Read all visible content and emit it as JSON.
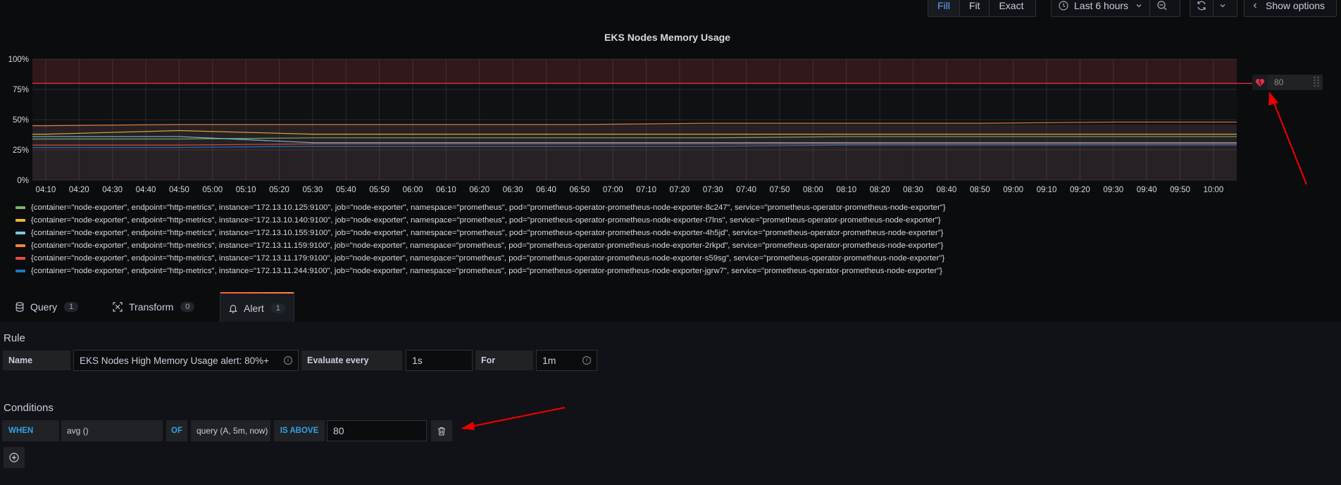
{
  "toolbar": {
    "fill_label": "Fill",
    "fit_label": "Fit",
    "exact_label": "Exact",
    "time_range": "Last 6 hours",
    "show_options_label": "Show options"
  },
  "graph": {
    "title": "EKS Nodes Memory Usage",
    "threshold_handle_value": "80",
    "y_ticks": [
      "100%",
      "75%",
      "50%",
      "25%",
      "0%"
    ],
    "x_ticks": [
      "04:10",
      "04:20",
      "04:30",
      "04:40",
      "04:50",
      "05:00",
      "05:10",
      "05:20",
      "05:30",
      "05:40",
      "05:50",
      "06:00",
      "06:10",
      "06:20",
      "06:30",
      "06:40",
      "06:50",
      "07:00",
      "07:10",
      "07:20",
      "07:30",
      "07:40",
      "07:50",
      "08:00",
      "08:10",
      "08:20",
      "08:30",
      "08:40",
      "08:50",
      "09:00",
      "09:10",
      "09:20",
      "09:30",
      "09:40",
      "09:50",
      "10:00"
    ]
  },
  "chart_data": {
    "type": "line",
    "title": "EKS Nodes Memory Usage",
    "xlabel": "",
    "ylabel": "",
    "ylim": [
      0,
      100
    ],
    "y_unit": "%",
    "threshold": 80,
    "x_range": [
      "04:06",
      "10:07"
    ],
    "categories": [
      "04:10",
      "04:50",
      "05:30",
      "06:10",
      "06:50",
      "07:30",
      "08:10",
      "08:50",
      "09:30",
      "10:00"
    ],
    "grid": true,
    "series": [
      {
        "name": "{container=\"node-exporter\", endpoint=\"http-metrics\", instance=\"172.13.10.125:9100\", job=\"node-exporter\", namespace=\"prometheus\", pod=\"prometheus-operator-prometheus-node-exporter-8c247\", service=\"prometheus-operator-prometheus-node-exporter\"}",
        "color": "#7eb26d",
        "values": [
          34,
          34,
          35,
          35,
          35,
          35,
          36,
          36,
          36,
          36
        ]
      },
      {
        "name": "{container=\"node-exporter\", endpoint=\"http-metrics\", instance=\"172.13.10.140:9100\", job=\"node-exporter\", namespace=\"prometheus\", pod=\"prometheus-operator-prometheus-node-exporter-t7lns\", service=\"prometheus-operator-prometheus-node-exporter\"}",
        "color": "#eab839",
        "values": [
          38,
          41,
          38,
          38,
          38,
          38,
          38,
          38,
          38,
          38
        ]
      },
      {
        "name": "{container=\"node-exporter\", endpoint=\"http-metrics\", instance=\"172.13.10.155:9100\", job=\"node-exporter\", namespace=\"prometheus\", pod=\"prometheus-operator-prometheus-node-exporter-4h5jd\", service=\"prometheus-operator-prometheus-node-exporter\"}",
        "color": "#6ed0e0",
        "values": [
          36,
          36,
          31,
          31,
          31,
          31,
          31,
          31,
          31,
          31
        ]
      },
      {
        "name": "{container=\"node-exporter\", endpoint=\"http-metrics\", instance=\"172.13.11.159:9100\", job=\"node-exporter\", namespace=\"prometheus\", pod=\"prometheus-operator-prometheus-node-exporter-2rkpd\", service=\"prometheus-operator-prometheus-node-exporter\"}",
        "color": "#ef843c",
        "values": [
          45,
          46,
          46,
          46,
          46,
          47,
          47,
          47,
          48,
          48
        ]
      },
      {
        "name": "{container=\"node-exporter\", endpoint=\"http-metrics\", instance=\"172.13.11.179:9100\", job=\"node-exporter\", namespace=\"prometheus\", pod=\"prometheus-operator-prometheus-node-exporter-s59sg\", service=\"prometheus-operator-prometheus-node-exporter\"}",
        "color": "#e24d42",
        "values": [
          29,
          29,
          30,
          30,
          30,
          30,
          30,
          30,
          30,
          30
        ]
      },
      {
        "name": "{container=\"node-exporter\", endpoint=\"http-metrics\", instance=\"172.13.11.244:9100\", job=\"node-exporter\", namespace=\"prometheus\", pod=\"prometheus-operator-prometheus-node-exporter-jgrw7\", service=\"prometheus-operator-prometheus-node-exporter\"}",
        "color": "#1f78c1",
        "values": [
          27,
          27,
          28,
          28,
          28,
          28,
          29,
          29,
          29,
          29
        ]
      }
    ]
  },
  "tabs": [
    {
      "label": "Query",
      "count": "1",
      "icon": "database-icon"
    },
    {
      "label": "Transform",
      "count": "0",
      "icon": "transform-icon"
    },
    {
      "label": "Alert",
      "count": "1",
      "icon": "bell-icon"
    }
  ],
  "rule": {
    "section_title": "Rule",
    "name_label": "Name",
    "name_value": "EKS Nodes High Memory Usage alert: 80%+",
    "evaluate_label": "Evaluate every",
    "evaluate_value": "1s",
    "for_label": "For",
    "for_value": "1m"
  },
  "conditions": {
    "section_title": "Conditions",
    "when_label": "WHEN",
    "reducer": "avg ()",
    "of_label": "OF",
    "query": "query (A, 5m, now)",
    "evaluator": "IS ABOVE",
    "threshold": "80"
  },
  "colors": {
    "threshold_line": "#e02f44",
    "alert_zone": "#3b1a1d",
    "annotation_arrow": "#e60000",
    "keyword_blue": "#33a2e5",
    "active_tab": "#6e9fff"
  }
}
